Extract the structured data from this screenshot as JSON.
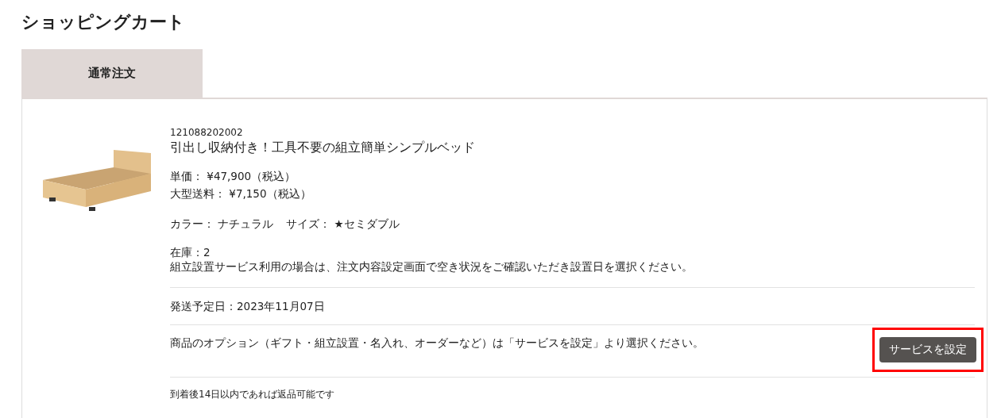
{
  "page_title": "ショッピングカート",
  "tabs": [
    {
      "label": "通常注文",
      "selected": true
    }
  ],
  "item": {
    "code": "121088202002",
    "name": "引出し収納付き！工具不要の組立簡単シンプルベッド",
    "prices": [
      "単価： ¥47,900（税込）",
      "大型送料： ¥7,150（税込）"
    ],
    "attributes": [
      "カラー： ナチュラル",
      "サイズ： ★セミダブル"
    ],
    "stock": "在庫：2",
    "notice": "組立設置サービス利用の場合は、注文内容設定画面で空き状況をご確認いただき設置日を選択ください。",
    "ship_date": "発送予定日：2023年11月07日",
    "options_note": "商品のオプション（ギフト・組立設置・名入れ、オーダーなど）は「サービスを設定」より選択ください。",
    "service_button": {
      "label": "サービスを設定",
      "highlighted": true
    },
    "return_note": "到着後14日以内であれば返品可能です"
  }
}
